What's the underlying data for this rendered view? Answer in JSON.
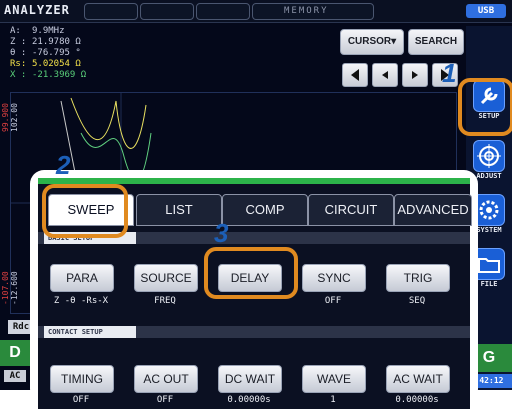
{
  "header": {
    "app_title": "ANALYZER",
    "memory_label": "MEMORY",
    "usb_label": "USB"
  },
  "readout": {
    "freq": {
      "label": "A:",
      "value": "9.9MHz"
    },
    "z": {
      "label": "Z :",
      "value": "21.9780 Ω"
    },
    "theta": {
      "label": "θ :",
      "value": "-76.795 °"
    },
    "rs": {
      "label": "Rs:",
      "value": "5.02054 Ω"
    },
    "x": {
      "label": "X :",
      "value": "-21.3969 Ω"
    }
  },
  "toolbar": {
    "cursor_label": "CURSOR▾",
    "search_label": "SEARCH"
  },
  "graph": {
    "y_top_label": "99.900",
    "y_top_label2": "102.00",
    "y_bottom_label": "-107.00",
    "y_bottom_label2": "-12.600"
  },
  "sidebar": {
    "items": [
      {
        "label": "SETUP",
        "icon": "wrench-icon"
      },
      {
        "label": "ADJUST",
        "icon": "target-icon"
      },
      {
        "label": "SYSTEM",
        "icon": "gear-icon"
      },
      {
        "label": "FILE",
        "icon": "folder-icon"
      }
    ]
  },
  "steps": {
    "one": "1",
    "two": "2",
    "three": "3"
  },
  "dialog": {
    "tabs": [
      "SWEEP",
      "LIST",
      "COMP",
      "CIRCUIT",
      "ADVANCED"
    ],
    "basic_setup_label": "BASIC SETUP",
    "contact_setup_label": "CONTACT SETUP",
    "basic_buttons": [
      {
        "label": "PARA",
        "value": "Z -θ -Rs-X"
      },
      {
        "label": "SOURCE",
        "value": "FREQ"
      },
      {
        "label": "DELAY",
        "value": ""
      },
      {
        "label": "SYNC",
        "value": "OFF"
      },
      {
        "label": "TRIG",
        "value": "SEQ"
      }
    ],
    "contact_buttons": [
      {
        "label": "TIMING",
        "value": "OFF"
      },
      {
        "label": "AC OUT",
        "value": "OFF"
      },
      {
        "label": "DC WAIT",
        "value": "0.00000s"
      },
      {
        "label": "WAVE",
        "value": "1"
      },
      {
        "label": "AC WAIT",
        "value": "0.00000s"
      }
    ]
  },
  "edges": {
    "rdc": "Rdc",
    "d": "D",
    "ac": "AC",
    "g": "G",
    "time": ":42:12"
  },
  "colors": {
    "accent_orange": "#e08a20",
    "step_blue": "#1c5fb8",
    "active_green": "#2cb34a",
    "rs_yellow": "#f2e04a",
    "x_green": "#5ad07a"
  }
}
